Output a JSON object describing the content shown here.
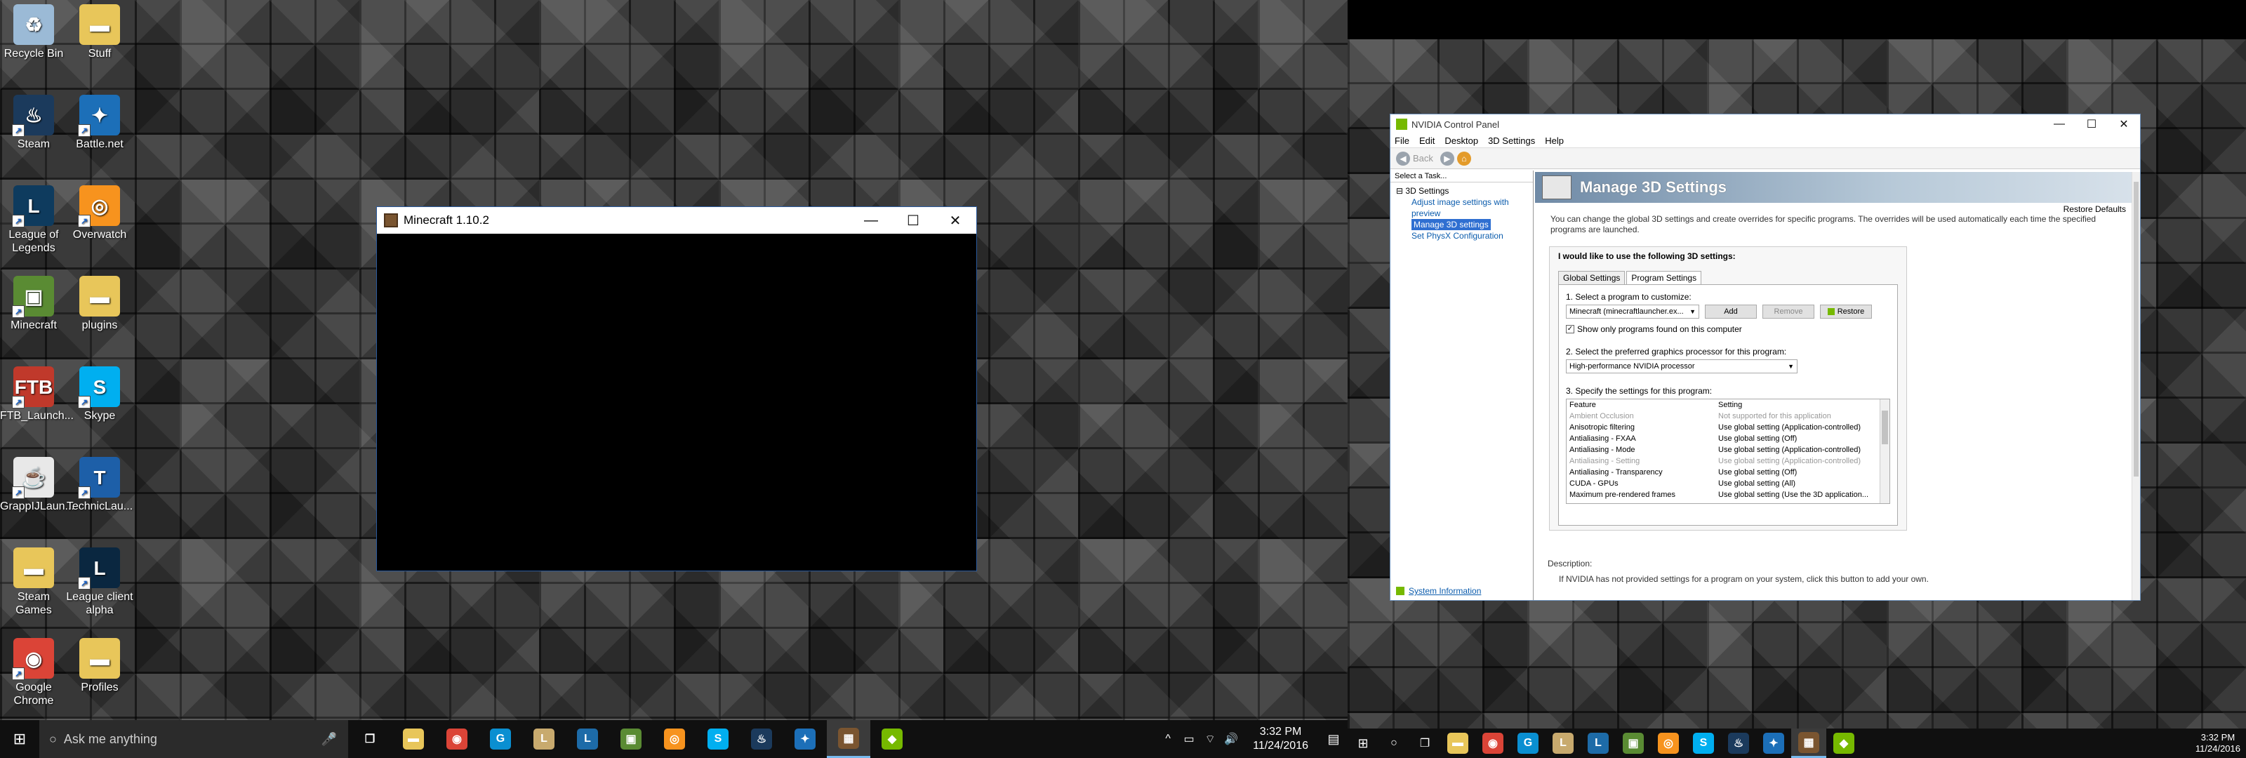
{
  "desktop_icons": [
    {
      "label": "Recycle Bin",
      "icon": "recycle-bin-icon",
      "color": "#9bbad6"
    },
    {
      "label": "Stuff",
      "icon": "folder-icon",
      "color": "#e8c65a"
    },
    {
      "label": "Steam",
      "icon": "steam-icon",
      "color": "#1b3a5c"
    },
    {
      "label": "Battle.net",
      "icon": "battlenet-icon",
      "color": "#1c6fb8"
    },
    {
      "label": "League of Legends",
      "icon": "league-icon",
      "color": "#0e3b5e"
    },
    {
      "label": "Overwatch",
      "icon": "overwatch-icon",
      "color": "#f7931e"
    },
    {
      "label": "Minecraft",
      "icon": "minecraft-icon",
      "color": "#5a8b33"
    },
    {
      "label": "plugins",
      "icon": "folder-icon",
      "color": "#e8c65a"
    },
    {
      "label": "FTB_Launch...",
      "icon": "ftb-icon",
      "color": "#c0392b"
    },
    {
      "label": "Skype",
      "icon": "skype-icon",
      "color": "#00aff0"
    },
    {
      "label": "GrappIJLaun...",
      "icon": "java-icon",
      "color": "#e8e8e8"
    },
    {
      "label": "TechnicLau...",
      "icon": "technic-icon",
      "color": "#1d5fa8"
    },
    {
      "label": "Steam Games",
      "icon": "folder-icon",
      "color": "#e8c65a"
    },
    {
      "label": "League client alpha",
      "icon": "league-client-icon",
      "color": "#0a2740"
    },
    {
      "label": "Google Chrome",
      "icon": "chrome-icon",
      "color": "#db4437"
    },
    {
      "label": "Profiles",
      "icon": "folder-icon",
      "color": "#e8c65a"
    }
  ],
  "minecraft_window": {
    "title": "Minecraft 1.10.2"
  },
  "window_controls": {
    "minimize": "—",
    "maximize": "☐",
    "close": "✕"
  },
  "taskbar_left": {
    "start": "⊞",
    "search_placeholder": "Ask me anything",
    "mic": "🎤",
    "task_view": "❐",
    "apps": [
      {
        "name": "file-explorer",
        "glyph": "▬",
        "color": "#e8c65a"
      },
      {
        "name": "chrome",
        "glyph": "◉",
        "color": "#db4437"
      },
      {
        "name": "logitech",
        "glyph": "G",
        "color": "#0a8fd1"
      },
      {
        "name": "league",
        "glyph": "L",
        "color": "#c8aa6e"
      },
      {
        "name": "league-client",
        "glyph": "L",
        "color": "#1d6ba8"
      },
      {
        "name": "minecraft",
        "glyph": "▣",
        "color": "#5a8b33"
      },
      {
        "name": "overwatch",
        "glyph": "◎",
        "color": "#f7931e"
      },
      {
        "name": "skype",
        "glyph": "S",
        "color": "#00aff0"
      },
      {
        "name": "steam",
        "glyph": "♨",
        "color": "#1b3a5c"
      },
      {
        "name": "battlenet",
        "glyph": "✦",
        "color": "#1c6fb8"
      },
      {
        "name": "minecraft-launcher",
        "glyph": "▦",
        "color": "#7a5530"
      },
      {
        "name": "nvidia",
        "glyph": "◆",
        "color": "#76b900"
      }
    ],
    "tray": [
      "^",
      "▭",
      "⌔",
      "🔊"
    ],
    "time": "3:32 PM",
    "date": "11/24/2016",
    "notifications": "▤"
  },
  "taskbar_right": {
    "time": "3:32 PM",
    "date": "11/24/2016"
  },
  "nvidia": {
    "title": "NVIDIA Control Panel",
    "menu": [
      "File",
      "Edit",
      "Desktop",
      "3D Settings",
      "Help"
    ],
    "back_label": "Back",
    "task_header": "Select a Task...",
    "tree_root": "3D Settings",
    "tree_children": [
      "Adjust image settings with preview",
      "Manage 3D settings",
      "Set PhysX Configuration"
    ],
    "system_info": "System Information",
    "page_title": "Manage 3D Settings",
    "restore_defaults": "Restore Defaults",
    "intro": "You can change the global 3D settings and create overrides for specific programs. The overrides will be used automatically each time the specified programs are launched.",
    "panel_header": "I would like to use the following 3D settings:",
    "tabs": [
      "Global Settings",
      "Program Settings"
    ],
    "step1": "1. Select a program to customize:",
    "program": "Minecraft (minecraftlauncher.ex...",
    "add": "Add",
    "remove": "Remove",
    "restore": "Restore",
    "show_only": "Show only programs found on this computer",
    "step2": "2. Select the preferred graphics processor for this program:",
    "processor": "High-performance NVIDIA processor",
    "step3": "3. Specify the settings for this program:",
    "col_feature": "Feature",
    "col_setting": "Setting",
    "features": [
      {
        "feature": "Ambient Occlusion",
        "setting": "Not supported for this application"
      },
      {
        "feature": "Anisotropic filtering",
        "setting": "Use global setting (Application-controlled)"
      },
      {
        "feature": "Antialiasing - FXAA",
        "setting": "Use global setting (Off)"
      },
      {
        "feature": "Antialiasing - Mode",
        "setting": "Use global setting (Application-controlled)"
      },
      {
        "feature": "Antialiasing - Setting",
        "setting": "Use global setting (Application-controlled)"
      },
      {
        "feature": "Antialiasing - Transparency",
        "setting": "Use global setting (Off)"
      },
      {
        "feature": "CUDA - GPUs",
        "setting": "Use global setting (All)"
      },
      {
        "feature": "Maximum pre-rendered frames",
        "setting": "Use global setting (Use the 3D application..."
      }
    ],
    "description_label": "Description:",
    "description_text": "If NVIDIA has not provided settings for a program on your system, click this button to add your own."
  }
}
